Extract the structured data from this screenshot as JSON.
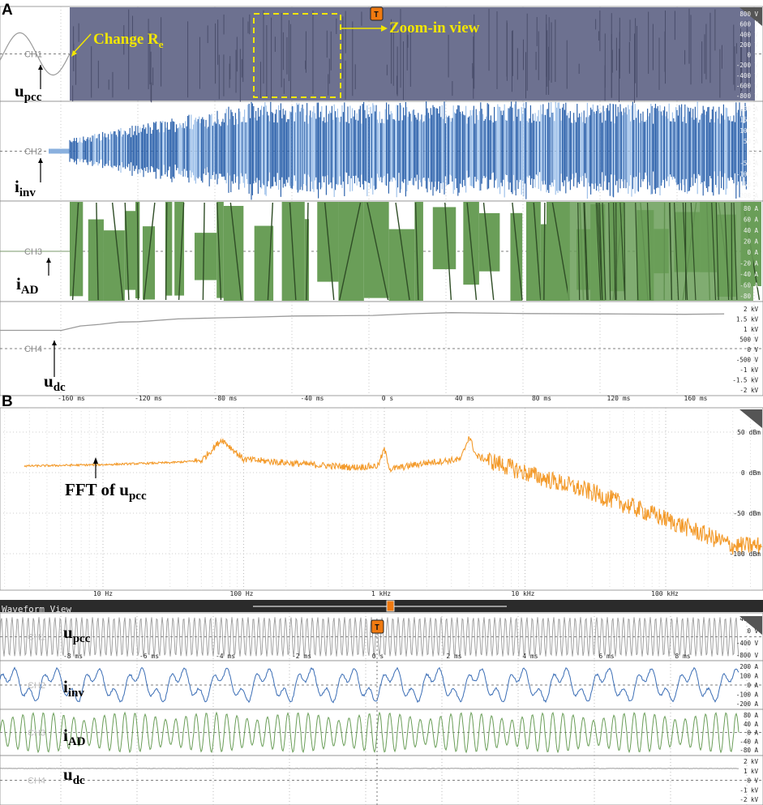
{
  "panels": {
    "a_label": "A",
    "b_label": "B"
  },
  "overview": {
    "channels": [
      {
        "id": "CH1",
        "signal": "u",
        "signal_sub": "pcc",
        "color": "#6a6f95",
        "ticks": [
          "800 V",
          "600 V",
          "400 V",
          "200 V",
          "0 V",
          "-200 V",
          "-400 V",
          "-600 V",
          "-800 V"
        ]
      },
      {
        "id": "CH2",
        "signal": "i",
        "signal_sub": "inv",
        "color": "#3a6db5",
        "ticks": [
          "200 A",
          "150 A",
          "100 A",
          "50 A",
          "0 A",
          "-50 A",
          "-100 A",
          "-150 A",
          "-200 A"
        ]
      },
      {
        "id": "CH3",
        "signal": "i",
        "signal_sub": "AD",
        "color": "#6a9e58",
        "ticks": [
          "80 A",
          "60 A",
          "40 A",
          "20 A",
          "0 A",
          "-20 A",
          "-40 A",
          "-60 A",
          "-80 A"
        ]
      },
      {
        "id": "CH4",
        "signal": "u",
        "signal_sub": "dc",
        "color": "#9a9a9a",
        "ticks": [
          "2 kV",
          "1.5 kV",
          "1 kV",
          "500 V",
          "0 V",
          "-500 V",
          "-1 kV",
          "-1.5 kV",
          "-2 kV"
        ]
      }
    ],
    "time_ticks": [
      "-160 ms",
      "-120 ms",
      "-80 ms",
      "-40 ms",
      "0 s",
      "40 ms",
      "80 ms",
      "120 ms",
      "160 ms"
    ],
    "annotation_change": "Change  R",
    "annotation_change_sub": "e",
    "annotation_zoom": "Zoom-in view",
    "trigger_marker": "T",
    "udc_trace": {
      "x_ms": [
        -160,
        -150,
        -140,
        -130,
        -120,
        -100,
        -80,
        -60,
        -40,
        -20,
        0,
        20,
        40,
        80,
        120,
        160,
        180
      ],
      "y_kV": [
        0.9,
        1.1,
        1.2,
        1.3,
        1.35,
        1.45,
        1.5,
        1.55,
        1.6,
        1.62,
        1.65,
        1.7,
        1.75,
        1.75,
        1.72,
        1.7,
        1.72
      ]
    }
  },
  "fft": {
    "label_prefix": "FFT of u",
    "label_sub": "pcc",
    "freq_ticks": [
      "10 Hz",
      "100 Hz",
      "1 kHz",
      "10 kHz",
      "100 kHz"
    ],
    "db_ticks": [
      "50 dBm",
      "0 dBm",
      "-50 dBm",
      "-100 dBm"
    ],
    "color": "#f39a2a"
  },
  "zoom": {
    "title": "Waveform View",
    "time_ticks": [
      "-8 ms",
      "-6 ms",
      "-4 ms",
      "-2 ms",
      "0 s",
      "2 ms",
      "4 ms",
      "6 ms",
      "8 ms"
    ],
    "channels": [
      {
        "id": "CH1",
        "signal": "u",
        "signal_sub": "pcc",
        "ticks": [
          "400 V",
          "0 V",
          "-400 V",
          "-800 V"
        ]
      },
      {
        "id": "CH2",
        "signal": "i",
        "signal_sub": "inv",
        "ticks": [
          "200 A",
          "100 A",
          "0 A",
          "-100 A",
          "-200 A"
        ]
      },
      {
        "id": "CH3",
        "signal": "i",
        "signal_sub": "AD",
        "ticks": [
          "80 A",
          "40 A",
          "0 A",
          "-40 A",
          "-80 A"
        ]
      },
      {
        "id": "CH4",
        "signal": "u",
        "signal_sub": "dc",
        "ticks": [
          "2 kV",
          "1 kV",
          "0 V",
          "-1 kV",
          "-2 kV"
        ]
      }
    ]
  },
  "chart_data": [
    {
      "type": "line",
      "title": "",
      "xlabel": "",
      "ylabel": "",
      "x_ticks": [
        "-160 ms",
        "-120 ms",
        "-80 ms",
        "-40 ms",
        "0 s",
        "40 ms",
        "80 ms",
        "120 ms",
        "160 ms"
      ],
      "series": [
        {
          "name": "u_dc",
          "x": [
            -160,
            -140,
            -120,
            -80,
            -40,
            0,
            40,
            80,
            120,
            160
          ],
          "values": [
            0.9,
            1.2,
            1.35,
            1.5,
            1.6,
            1.65,
            1.75,
            1.75,
            1.72,
            1.7
          ]
        }
      ],
      "ylim_kV": [
        -2,
        2
      ]
    },
    {
      "type": "line",
      "title": "",
      "x_ticks": [
        "10 Hz",
        "100 Hz",
        "1 kHz",
        "10 kHz",
        "100 kHz"
      ],
      "y_ticks": [
        "50 dBm",
        "0 dBm",
        "-50 dBm",
        "-100 dBm"
      ],
      "series": [
        {
          "name": "FFT of u_pcc",
          "x_hz": [
            3,
            10,
            30,
            50,
            70,
            100,
            300,
            600,
            900,
            1000,
            1100,
            2000,
            3500,
            4000,
            4500,
            10000,
            30000,
            100000,
            300000
          ],
          "values_dbm": [
            10,
            12,
            15,
            18,
            50,
            20,
            12,
            8,
            10,
            35,
            5,
            15,
            20,
            55,
            25,
            0,
            -30,
            -70,
            -110
          ]
        }
      ]
    }
  ]
}
